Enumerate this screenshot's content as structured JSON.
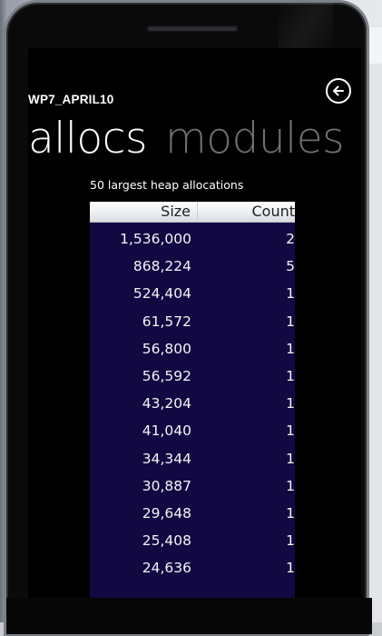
{
  "app": {
    "title": "WP7_APRIL10"
  },
  "pivot": {
    "tabs": [
      {
        "label": "allocs",
        "active": true
      },
      {
        "label": "modules",
        "active": false
      }
    ]
  },
  "allocations": {
    "caption": "50 largest heap allocations",
    "columns": {
      "size": "Size",
      "count": "Count"
    },
    "rows": [
      {
        "size": "1,536,000",
        "count": "2"
      },
      {
        "size": "868,224",
        "count": "5"
      },
      {
        "size": "524,404",
        "count": "1"
      },
      {
        "size": "61,572",
        "count": "1"
      },
      {
        "size": "56,800",
        "count": "1"
      },
      {
        "size": "56,592",
        "count": "1"
      },
      {
        "size": "43,204",
        "count": "1"
      },
      {
        "size": "41,040",
        "count": "1"
      },
      {
        "size": "34,344",
        "count": "1"
      },
      {
        "size": "30,887",
        "count": "1"
      },
      {
        "size": "29,648",
        "count": "1"
      },
      {
        "size": "25,408",
        "count": "1"
      },
      {
        "size": "24,636",
        "count": "1"
      }
    ]
  },
  "icons": {
    "back": "back-arrow-circle-icon"
  },
  "colors": {
    "table_background": "#120942",
    "inactive_tab": "#6f6f6f",
    "screen_background": "#000000"
  }
}
